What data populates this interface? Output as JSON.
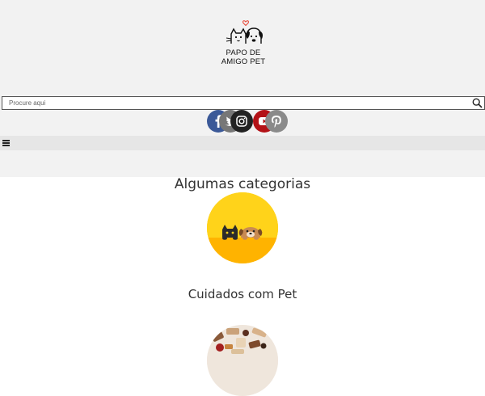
{
  "logo": {
    "line1": "PAPO DE",
    "line2": "AMIGO PET"
  },
  "search": {
    "placeholder": "Procure aqui",
    "icon": "search-icon"
  },
  "social": [
    {
      "name": "facebook",
      "color": "#3b5998"
    },
    {
      "name": "twitter",
      "color": "#777777"
    },
    {
      "name": "instagram",
      "color": "#222222"
    },
    {
      "name": "youtube",
      "color": "#b31217"
    },
    {
      "name": "pinterest",
      "color": "#8a8a8a"
    }
  ],
  "nav": {
    "icon": "menu-icon"
  },
  "categories_section": {
    "title": "Algumas categorias",
    "items": [
      {
        "label": "Cuidados com Pet"
      }
    ]
  }
}
